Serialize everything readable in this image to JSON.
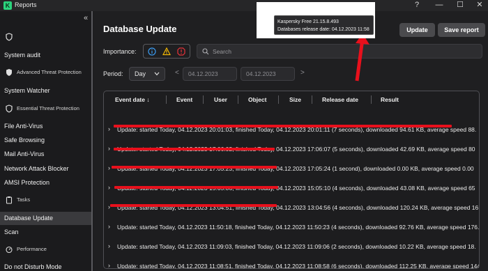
{
  "window": {
    "title": "Reports",
    "logo_letter": "K",
    "help": "?",
    "minimize": "—",
    "maximize": "☐",
    "close": "✕"
  },
  "sidebar": {
    "collapse": "«",
    "items": [
      {
        "label": "System audit"
      },
      {
        "label": "Advanced Threat Protection"
      },
      {
        "label": "System Watcher"
      },
      {
        "label": "Essential Threat Protection"
      },
      {
        "label": "File Anti-Virus"
      },
      {
        "label": "Safe Browsing"
      },
      {
        "label": "Mail Anti-Virus"
      },
      {
        "label": "Network Attack Blocker"
      },
      {
        "label": "AMSI Protection"
      },
      {
        "label": "Tasks"
      },
      {
        "label": "Database Update"
      },
      {
        "label": "Scan"
      },
      {
        "label": "Performance"
      },
      {
        "label": "Do not Disturb Mode"
      }
    ]
  },
  "header": {
    "title": "Database Update",
    "update_label": "Update",
    "save_report_label": "Save report"
  },
  "filters": {
    "importance_label": "Importance:",
    "search_placeholder": "Search",
    "period_label": "Period:",
    "period_value": "Day",
    "date_from": "04.12.2023",
    "date_to": "04.12.2023",
    "prev": "<",
    "next": ">"
  },
  "table": {
    "columns": [
      "Event date ↓",
      "Event",
      "User",
      "Object",
      "Size",
      "Release date",
      "Result"
    ],
    "rows": [
      "Update: started Today, 04.12.2023 20:01:03, finished Today, 04.12.2023 20:01:11 (7 seconds), downloaded 94.61 KB, average speed 88.",
      "Update: started Today, 04.12.2023 17:06:02, finished Today, 04.12.2023 17:06:07 (5 seconds), downloaded 42.69 KB, average speed 80",
      "Update: started Today, 04.12.2023 17:05:23, finished Today, 04.12.2023 17:05:24 (1 second), downloaded 0.00 KB, average speed 0.00",
      "Update: started Today, 04.12.2023 15:05:06, finished Today, 04.12.2023 15:05:10 (4 seconds), downloaded 43.08 KB, average speed 65",
      "Update: started Today, 04.12.2023 13:04:51, finished Today, 04.12.2023 13:04:56 (4 seconds), downloaded 120.24 KB, average speed 16",
      "Update: started Today, 04.12.2023 11:50:18, finished Today, 04.12.2023 11:50:23 (4 seconds), downloaded 92.76 KB, average speed 176.",
      "Update: started Today, 04.12.2023 11:09:03, finished Today, 04.12.2023 11:09:06 (2 seconds), downloaded 10.22 KB, average speed 18.",
      "Update: started Today, 04.12.2023 11:08:51, finished Today, 04.12.2023 11:08:58 (6 seconds), downloaded 112.25 KB, average speed 144"
    ]
  },
  "tooltip": {
    "line1": "Kaspersky Free 21.15.8.493",
    "line2": "Databases release date: 04.12.2023 11:58"
  },
  "colors": {
    "accent_red": "#e8101c",
    "info_blue": "#3b9bf0",
    "warn_yellow": "#f2b705",
    "critical_red": "#e8333a"
  }
}
